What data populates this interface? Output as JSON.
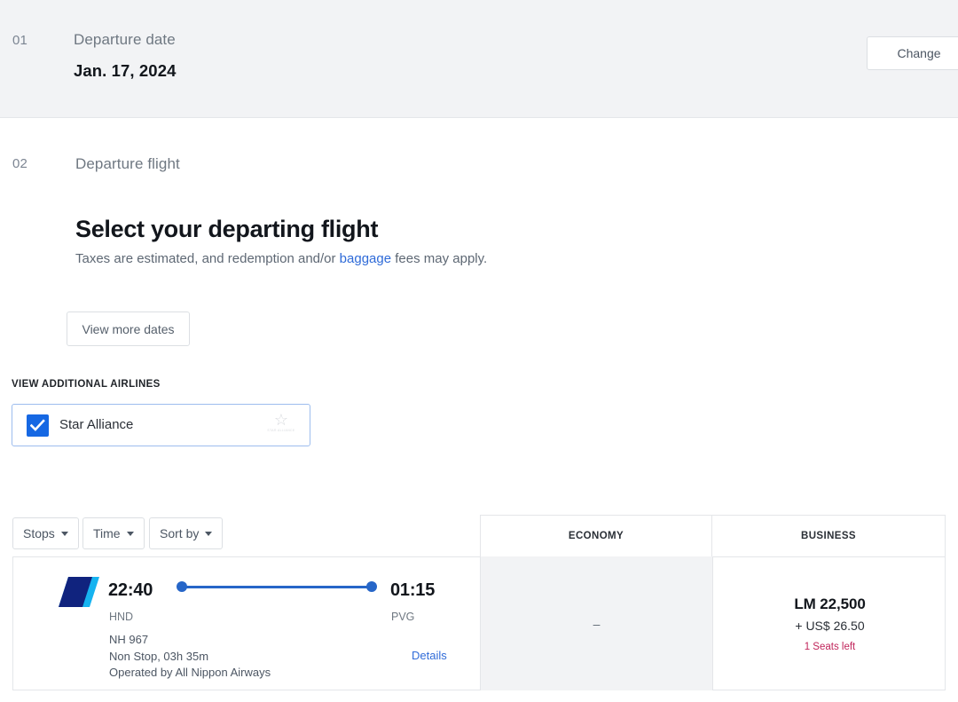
{
  "step_one": {
    "number": "01",
    "label": "Departure date",
    "value": "Jan. 17, 2024",
    "change_label": "Change"
  },
  "step_two": {
    "number": "02",
    "label": "Departure flight",
    "heading": "Select your departing flight",
    "subheading_before": "Taxes are estimated, and redemption and/or ",
    "subheading_link": "baggage",
    "subheading_after": " fees may apply.",
    "view_more_dates_label": "View more dates"
  },
  "additional_airlines": {
    "section_label": "VIEW ADDITIONAL AIRLINES",
    "option_label": "Star Alliance",
    "checked": true,
    "logo_caption": "STAR ALLIANCE"
  },
  "filters": [
    {
      "label": "Stops",
      "icon": "chevron-down-icon"
    },
    {
      "label": "Time",
      "icon": "chevron-down-icon"
    },
    {
      "label": "Sort by",
      "icon": "chevron-down-icon"
    }
  ],
  "table": {
    "columns": [
      {
        "key": "economy",
        "label": "ECONOMY"
      },
      {
        "key": "business",
        "label": "BUSINESS"
      }
    ],
    "rows": [
      {
        "airline_logo": "ana-logo-icon",
        "depart_time": "22:40",
        "depart_code": "HND",
        "arrive_time": "01:15",
        "arrive_code": "PVG",
        "flight_number": "NH 967",
        "stops_duration": "Non Stop, 03h 35m",
        "operated_by": "Operated by All Nippon Airways",
        "details_label": "Details",
        "economy": {
          "value": "–",
          "available": false
        },
        "business": {
          "miles": "LM 22,500",
          "tax": "+ US$ 26.50",
          "seats_left": "1 Seats left"
        }
      }
    ]
  },
  "colors": {
    "accent_blue": "#2666c8",
    "link_blue": "#2f6bd8",
    "checkbox_blue": "#1668e3",
    "seats_red": "#c0245a",
    "panel_gray": "#f2f3f5",
    "border_gray": "#e4e6e9"
  }
}
